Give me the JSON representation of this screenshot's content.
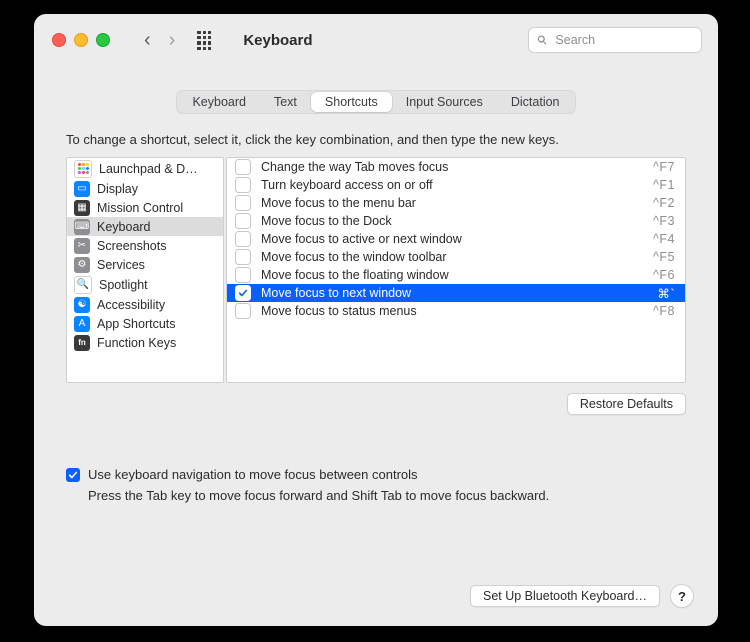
{
  "header": {
    "title": "Keyboard",
    "search_placeholder": "Search"
  },
  "tabs": [
    {
      "label": "Keyboard",
      "selected": false
    },
    {
      "label": "Text",
      "selected": false
    },
    {
      "label": "Shortcuts",
      "selected": true
    },
    {
      "label": "Input Sources",
      "selected": false
    },
    {
      "label": "Dictation",
      "selected": false
    }
  ],
  "main": {
    "instruction": "To change a shortcut, select it, click the key combination, and then type the new keys.",
    "restore_label": "Restore Defaults"
  },
  "categories": [
    {
      "label": "Launchpad & D…",
      "icon": "launchpad",
      "selected": false
    },
    {
      "label": "Display",
      "icon": "display",
      "selected": false
    },
    {
      "label": "Mission Control",
      "icon": "mission",
      "selected": false
    },
    {
      "label": "Keyboard",
      "icon": "keyboard",
      "selected": true
    },
    {
      "label": "Screenshots",
      "icon": "screenshot",
      "selected": false
    },
    {
      "label": "Services",
      "icon": "services",
      "selected": false
    },
    {
      "label": "Spotlight",
      "icon": "spotlight",
      "selected": false
    },
    {
      "label": "Accessibility",
      "icon": "a11y",
      "selected": false
    },
    {
      "label": "App Shortcuts",
      "icon": "apps",
      "selected": false
    },
    {
      "label": "Function Keys",
      "icon": "fn",
      "selected": false
    }
  ],
  "shortcuts": [
    {
      "checked": false,
      "label": "Change the way Tab moves focus",
      "keys": "^F7",
      "selected": false
    },
    {
      "checked": false,
      "label": "Turn keyboard access on or off",
      "keys": "^F1",
      "selected": false
    },
    {
      "checked": false,
      "label": "Move focus to the menu bar",
      "keys": "^F2",
      "selected": false
    },
    {
      "checked": false,
      "label": "Move focus to the Dock",
      "keys": "^F3",
      "selected": false
    },
    {
      "checked": false,
      "label": "Move focus to active or next window",
      "keys": "^F4",
      "selected": false
    },
    {
      "checked": false,
      "label": "Move focus to the window toolbar",
      "keys": "^F5",
      "selected": false
    },
    {
      "checked": false,
      "label": "Move focus to the floating window",
      "keys": "^F6",
      "selected": false
    },
    {
      "checked": true,
      "label": "Move focus to next window",
      "keys": "⌘`",
      "selected": true
    },
    {
      "checked": false,
      "label": "Move focus to status menus",
      "keys": "^F8",
      "selected": false
    }
  ],
  "options": {
    "kb_nav_checked": true,
    "kb_nav_label": "Use keyboard navigation to move focus between controls",
    "kb_nav_sub": "Press the Tab key to move focus forward and Shift Tab to move focus backward."
  },
  "footer": {
    "bt_label": "Set Up Bluetooth Keyboard…",
    "help_label": "?"
  },
  "icons": {
    "launchpad": {
      "bg": "#ffffff",
      "glyph": "grid-color"
    },
    "display": {
      "bg": "#0a84ff",
      "glyph": "▭"
    },
    "mission": {
      "bg": "#3a3a3c",
      "glyph": "▦"
    },
    "keyboard": {
      "bg": "#8e8e93",
      "glyph": "⌨"
    },
    "screenshot": {
      "bg": "#8e8e93",
      "glyph": "✂"
    },
    "services": {
      "bg": "#8e8e93",
      "glyph": "⚙"
    },
    "spotlight": {
      "bg": "#ffffff",
      "glyph": "🔍"
    },
    "a11y": {
      "bg": "#0a84ff",
      "glyph": "☯"
    },
    "apps": {
      "bg": "#0a84ff",
      "glyph": "A"
    },
    "fn": {
      "bg": "#3a3a3c",
      "glyph": "fn"
    }
  }
}
